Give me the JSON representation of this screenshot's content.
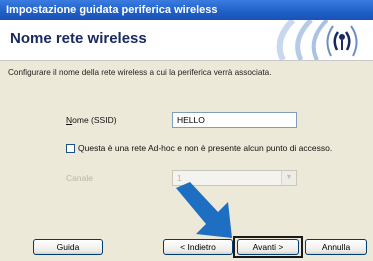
{
  "window": {
    "title": "Impostazione guidata periferica wireless"
  },
  "header": {
    "title": "Nome rete wireless",
    "icon": "wireless-signal-icon"
  },
  "description": "Configurare il nome della rete wireless a cui la periferica verrà associata.",
  "form": {
    "ssid_label": "Nome (SSID)",
    "ssid_value": "HELLO",
    "adhoc_label": "Questa è una rete Ad-hoc e non è presente alcun punto di accesso.",
    "adhoc_checked": false,
    "channel_label": "Canale",
    "channel_value": "1"
  },
  "buttons": {
    "help": "Guida",
    "back": "< Indietro",
    "next": "Avanti >",
    "cancel": "Annulla"
  },
  "colors": {
    "titlebar": "#1f5fc8",
    "header_title": "#1a2a60",
    "arrow": "#1e6fc2"
  }
}
